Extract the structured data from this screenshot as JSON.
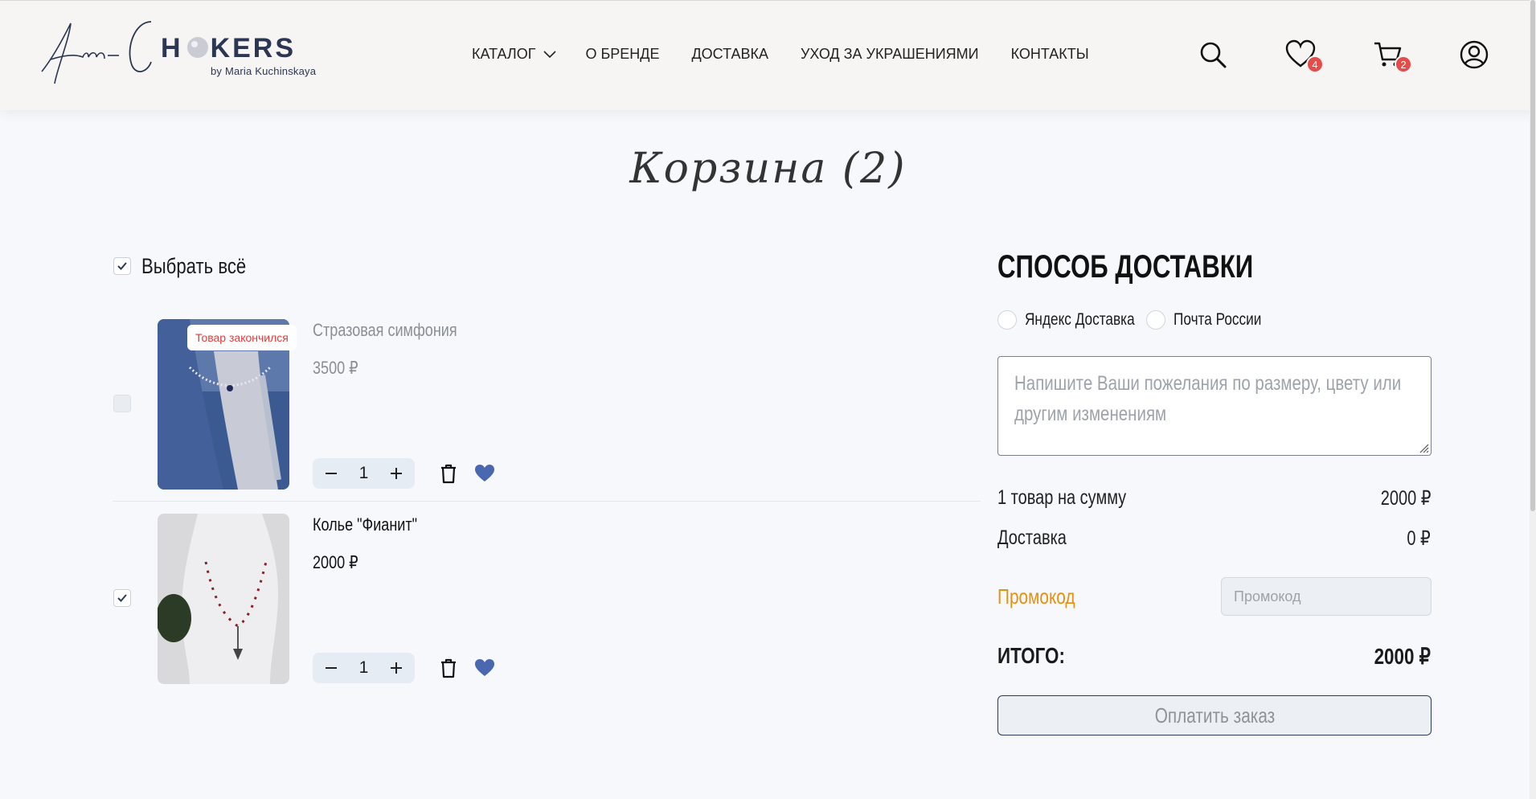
{
  "header": {
    "logo_text": "Am-CHOKERS",
    "logo_sub": "by Maria Kuchinskaya",
    "nav": [
      "КАТАЛОГ",
      "О БРЕНДЕ",
      "ДОСТАВКА",
      "УХОД ЗА УКРАШЕНИЯМИ",
      "КОНТАКТЫ"
    ],
    "icons": [
      "search-icon",
      "heart-icon",
      "cart-icon",
      "user-icon"
    ],
    "favorites_count": "4",
    "cart_count": "2"
  },
  "page_title": "Корзина (2)",
  "cart": {
    "select_all_label": "Выбрать всё",
    "items": [
      {
        "name": "Стразовая симфония",
        "price": "3500 ₽",
        "quantity": "1",
        "badge": "Товар закончился",
        "checked": false,
        "available": false
      },
      {
        "name": "Колье \"Фианит\"",
        "price": "2000 ₽",
        "quantity": "1",
        "checked": true,
        "available": true
      }
    ]
  },
  "summary": {
    "delivery_title": "СПОСОБ ДОСТАВКИ",
    "delivery_options": [
      "Яндекс Доставка",
      "Почта России"
    ],
    "wishes_placeholder": "Напишите Ваши пожелания по размеру, цвету или другим изменениям",
    "items_label": "1 товар на сумму",
    "items_sum": "2000 ₽",
    "delivery_label": "Доставка",
    "delivery_cost": "0 ₽",
    "promo_label": "Промокод",
    "promo_placeholder": "Промокод",
    "total_label": "ИТОГО:",
    "total_value": "2000 ₽",
    "pay_button": "Оплатить заказ"
  },
  "colors": {
    "accent_navy": "#2c3b57",
    "heart_blue": "#4a68b0",
    "promo_orange": "#e8900e",
    "badge_red": "#e84a4a"
  }
}
